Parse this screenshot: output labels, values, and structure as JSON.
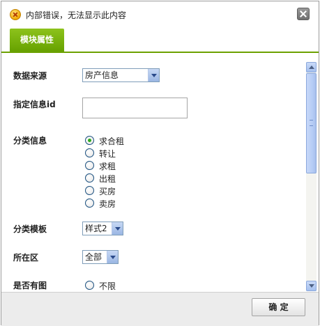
{
  "dialog": {
    "title": "内部错误，无法显示此内容",
    "ok_label": "确 定"
  },
  "tab": {
    "label": "模块属性"
  },
  "form": {
    "data_source": {
      "label": "数据来源",
      "value": "房产信息"
    },
    "info_id": {
      "label": "指定信息id",
      "value": ""
    },
    "category": {
      "label": "分类信息",
      "options": [
        "求合租",
        "转让",
        "求租",
        "出租",
        "买房",
        "卖房"
      ],
      "selected": "求合租"
    },
    "template": {
      "label": "分类模板",
      "value": "样式2"
    },
    "district": {
      "label": "所在区",
      "value": "全部"
    },
    "has_image": {
      "label": "是否有图",
      "first_option": "不限"
    }
  },
  "colors": {
    "tab_green": "#6ca100",
    "checked_dot": "#2eaa1d"
  }
}
